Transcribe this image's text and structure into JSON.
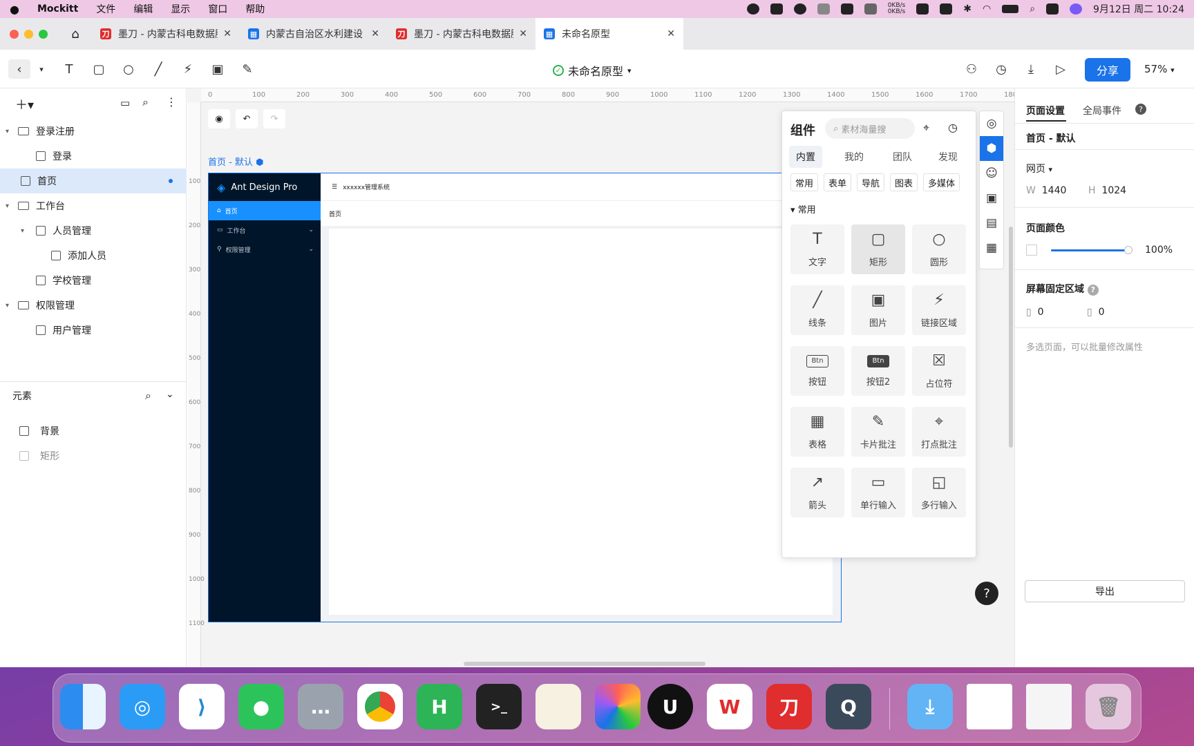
{
  "menubar": {
    "app_name": "Mockitt",
    "items": [
      "文件",
      "编辑",
      "显示",
      "窗口",
      "帮助"
    ],
    "net_up": "0KB/s",
    "net_down": "0KB/s",
    "datetime": "9月12日 周二 10:24"
  },
  "tabs": [
    {
      "title": "墨刀 - 内蒙古科电数据服",
      "favicon_color": "#e02d2d",
      "favicon_glyph": "刀"
    },
    {
      "title": "内蒙古自治区水利建设 信",
      "favicon_color": "#1a73e8",
      "favicon_glyph": "▦"
    },
    {
      "title": "墨刀 - 内蒙古科电数据服",
      "favicon_color": "#e02d2d",
      "favicon_glyph": "刀"
    },
    {
      "title": "未命名原型",
      "favicon_color": "#1a73e8",
      "favicon_glyph": "▦"
    }
  ],
  "toolbar": {
    "doc_title": "未命名原型",
    "share_label": "分享",
    "zoom": "57%"
  },
  "pages_tree": [
    {
      "label": "登录注册",
      "type": "folder",
      "level": 0
    },
    {
      "label": "登录",
      "type": "page",
      "level": 1
    },
    {
      "label": "首页",
      "type": "page",
      "level": 0,
      "selected": true
    },
    {
      "label": "工作台",
      "type": "folder",
      "level": 0
    },
    {
      "label": "人员管理",
      "type": "page",
      "level": 1
    },
    {
      "label": "添加人员",
      "type": "page",
      "level": 2
    },
    {
      "label": "学校管理",
      "type": "page",
      "level": 1
    },
    {
      "label": "权限管理",
      "type": "folder",
      "level": 0
    },
    {
      "label": "用户管理",
      "type": "page",
      "level": 1
    }
  ],
  "elements": {
    "header": "元素",
    "items": [
      "背景",
      "矩形"
    ]
  },
  "canvas": {
    "ruler_h": [
      "0",
      "100",
      "200",
      "300",
      "400",
      "500",
      "600",
      "700",
      "800",
      "900",
      "1000",
      "1100",
      "1200",
      "1300",
      "1400",
      "1500",
      "1600",
      "1700",
      "180"
    ],
    "ruler_v": [
      "100",
      "200",
      "300",
      "400",
      "500",
      "600",
      "700",
      "800",
      "900",
      "1000",
      "1100"
    ],
    "artboard_label": "首页 - 默认",
    "ant": {
      "logo": "Ant Design Pro",
      "header_title": "xxxxxx管理系统",
      "menu": [
        "首页",
        "工作台",
        "权限管理"
      ],
      "breadcrumb": "首页"
    }
  },
  "components": {
    "title": "组件",
    "search_placeholder": "素材海量搜",
    "tabs": [
      "内置",
      "我的",
      "团队",
      "发现"
    ],
    "chips": [
      "常用",
      "表单",
      "导航",
      "图表",
      "多媒体"
    ],
    "section": "常用",
    "tiles": [
      {
        "label": "文字",
        "icon": "T"
      },
      {
        "label": "矩形",
        "icon": "▢"
      },
      {
        "label": "圆形",
        "icon": "○"
      },
      {
        "label": "线条",
        "icon": "╱"
      },
      {
        "label": "图片",
        "icon": "▣"
      },
      {
        "label": "链接区域",
        "icon": "⚡"
      },
      {
        "label": "按钮",
        "icon": "Btn"
      },
      {
        "label": "按钮2",
        "icon": "Btn"
      },
      {
        "label": "占位符",
        "icon": "☒"
      },
      {
        "label": "表格",
        "icon": "▦"
      },
      {
        "label": "卡片批注",
        "icon": "✎"
      },
      {
        "label": "打点批注",
        "icon": "⌖"
      },
      {
        "label": "箭头",
        "icon": "↗"
      },
      {
        "label": "单行输入",
        "icon": "▭"
      },
      {
        "label": "多行输入",
        "icon": "◱"
      }
    ]
  },
  "rightpanel": {
    "tab_page": "页面设置",
    "tab_events": "全局事件",
    "page_name": "首页 - 默认",
    "device": "网页",
    "w_label": "W",
    "w": "1440",
    "h_label": "H",
    "h": "1024",
    "color_label": "页面颜色",
    "opacity": "100%",
    "fixed_label": "屏幕固定区域",
    "fixed_top": "0",
    "fixed_bottom": "0",
    "hint": "多选页面，可以批量修改属性",
    "export": "导出"
  }
}
